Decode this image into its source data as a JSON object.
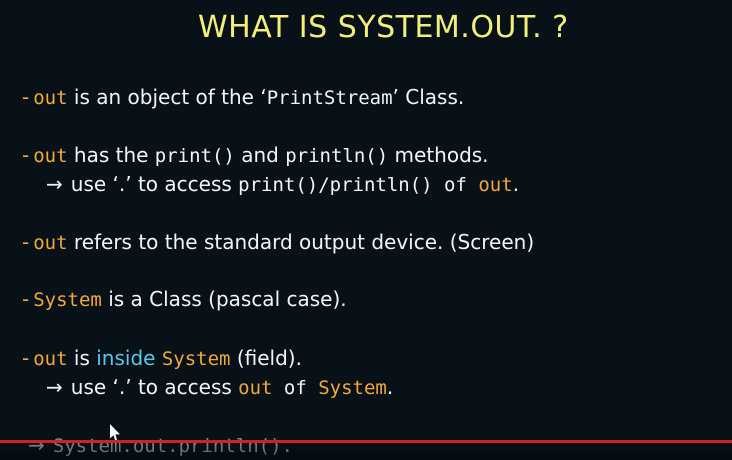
{
  "title": "WHAT IS SYSTEM.OUT. ?",
  "lines": {
    "l1": {
      "dash": "-",
      "kw": "out",
      "text1": " is an object of the ‘",
      "code": "PrintStream",
      "text2": "’ Class."
    },
    "l2": {
      "dash": "-",
      "kw": "out",
      "text1": " has the ",
      "code1": "print()",
      "text2": " and ",
      "code2": "println()",
      "text3": " methods."
    },
    "l3": {
      "arrow": "→",
      "text1": "use ‘.’ to access ",
      "code1": "print()/println() of ",
      "kw": "out",
      "end": "."
    },
    "l4": {
      "dash": "-",
      "kw": "out",
      "text1": "  refers to the standard output device. (Screen)"
    },
    "l5": {
      "dash": "-",
      "kw": "System",
      "text1": " is a Class (pascal case)."
    },
    "l6": {
      "dash": "-",
      "kw": "out",
      "text1": " is ",
      "blue": "inside",
      "text2": " ",
      "kw2": "System",
      "text3": " (field)."
    },
    "l7": {
      "arrow": "→",
      "text1": "use ‘.’ to access ",
      "kw": "out",
      "text2": " of ",
      "kw2": "System",
      "end": "."
    },
    "l8": {
      "arrow": "→",
      "code": "System.out.println()."
    }
  },
  "colors": {
    "background": "#071117",
    "title": "#f3ee7a",
    "keyword": "#f2a83b",
    "highlight": "#58c7e8",
    "progress": "#d51f27"
  }
}
